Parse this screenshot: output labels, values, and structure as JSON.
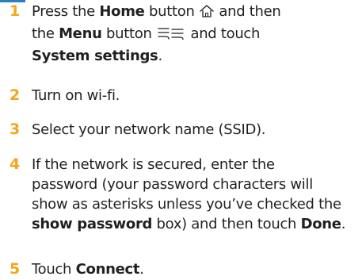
{
  "colors": {
    "accent": "#f5a51b",
    "text": "#231f20",
    "icon": "#231f20"
  },
  "icons": [
    "home-icon",
    "menu-icon"
  ],
  "steps": [
    {
      "number": "1",
      "l1_a": "Press the ",
      "l1_home": "Home",
      "l1_b": " button ",
      "l1_c": " and then",
      "l2_a": "the ",
      "l2_menu": "Menu",
      "l2_b": " button ",
      "l2_c": " and touch",
      "l3_settings": "System settings",
      "l3_end": "."
    },
    {
      "number": "2",
      "text": "Turn on wi-fi."
    },
    {
      "number": "3",
      "text": "Select your network name (SSID)."
    },
    {
      "number": "4",
      "l1": "If the network is secured, enter the",
      "l2": "password (your password characters will",
      "l3": "show as asterisks unless you’ve checked the",
      "l4_bold": "show password",
      "l4_a": " box) and then touch ",
      "l4_done": "Done",
      "l4_end": "."
    },
    {
      "number": "5",
      "prefix": "Touch ",
      "bold": "Connect",
      "suffix": "."
    }
  ]
}
